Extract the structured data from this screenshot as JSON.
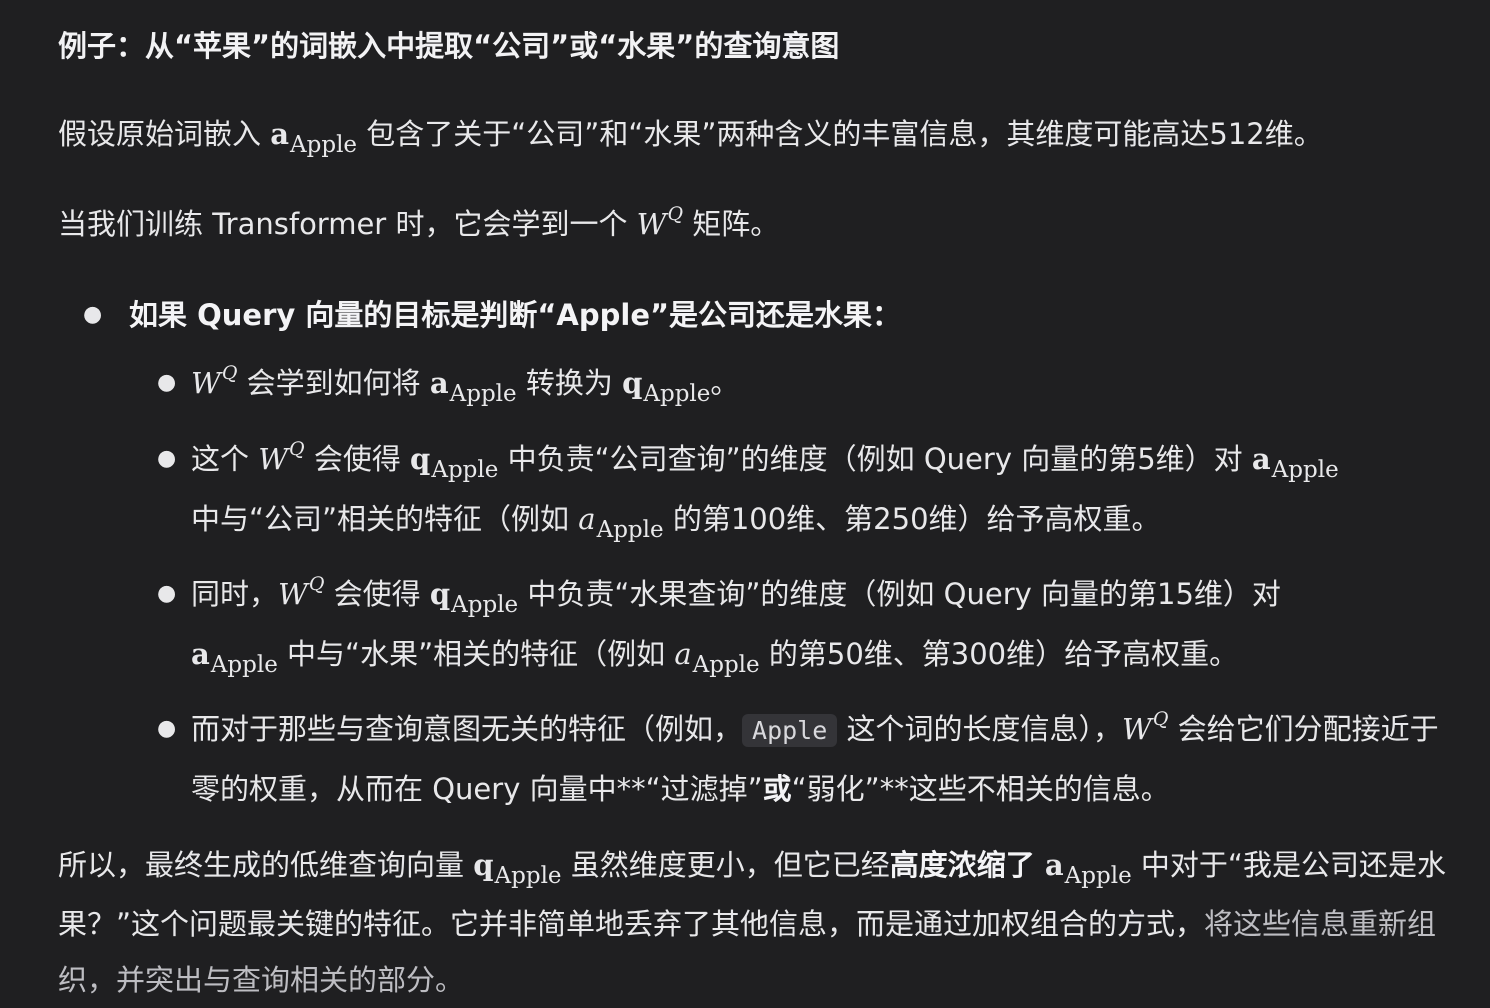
{
  "heading": "例子：从“苹果”的词嵌入中提取“公司”或“水果”的查询意图",
  "symbols": {
    "a": "a",
    "q": "q",
    "W": "W",
    "Q": "Q",
    "apple_sub": "Apple",
    "a_italic": "a"
  },
  "p1": {
    "before": "假设原始词嵌入 ",
    "after": " 包含了关于“公司”和“水果”两种含义的丰富信息，其维度可能高达512维。"
  },
  "p2": {
    "before": "当我们训练 Transformer 时，它会学到一个 ",
    "after": " 矩阵。"
  },
  "bullet1": {
    "text": "如果 Query 向量的目标是判断“Apple”是公司还是水果："
  },
  "sub1": {
    "mid": " 会学到如何将 ",
    "mid2": " 转换为 ",
    "end": "。"
  },
  "sub2": {
    "start": "这个 ",
    "mid": " 会使得 ",
    "mid2": " 中负责“公司查询”的维度（例如 Query 向量的第5维）对 ",
    "mid3": "中与“公司”相关的特征（例如 ",
    "end": " 的第100维、第250维）给予高权重。"
  },
  "sub3": {
    "start": "同时，",
    "mid": " 会使得 ",
    "mid2": " 中负责“水果查询”的维度（例如 Query 向量的第15维）对",
    "mid3": " 中与“水果”相关的特征（例如 ",
    "end": " 的第50维、第300维）给予高权重。"
  },
  "sub4": {
    "start": "而对于那些与查询意图无关的特征（例如，",
    "code": "Apple",
    "mid": " 这个词的长度信息），",
    "mid2": " 会给它们分配接近于零的权重，从而在 Query 向量中**“过滤掉”",
    "bold": "或",
    "end": "“弱化”**这些不相关的信息。"
  },
  "final": {
    "start": "所以，最终生成的低维查询向量 ",
    "mid": " 虽然维度更小，但它已经",
    "bold": "高度浓缩了 ",
    "mid2": " 中对于“我是公司还是水果？”这个问题最关键的特征。它并非简单地丢弃了其他信息，而是通过加权组合的方式，",
    "fade": "将这些信息重新组织，并突出与查询相关的部分。"
  },
  "colors": {
    "background": "#1f1f21",
    "text": "#e8e8ea",
    "code_bg": "#343438"
  }
}
